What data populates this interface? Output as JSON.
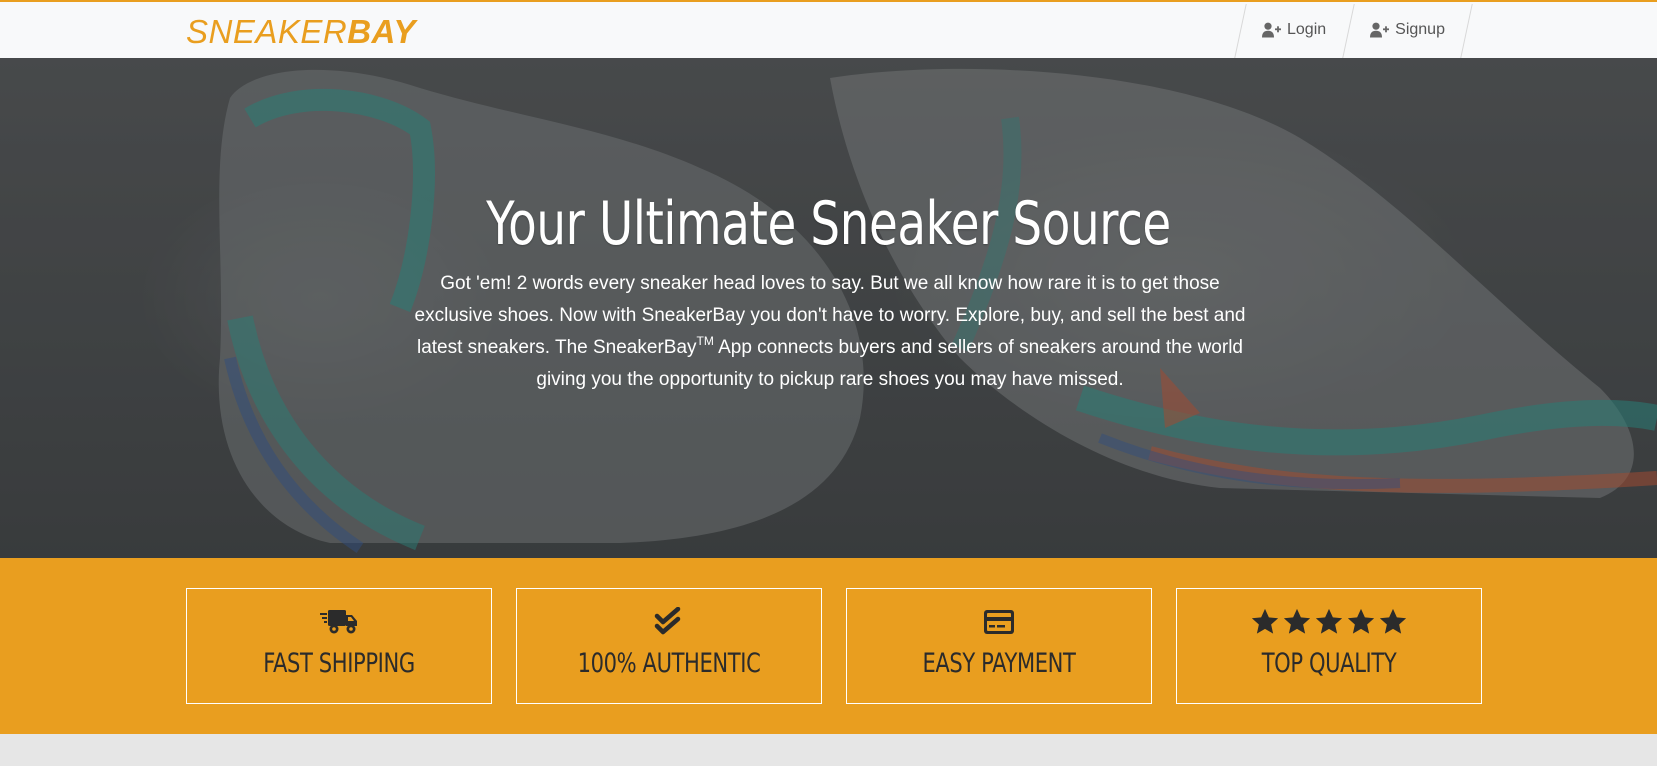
{
  "colors": {
    "accent": "#e99e1f",
    "navbar_bg": "#f8f9fa",
    "hero_text": "#ffffff",
    "feature_text": "#2b2b2b",
    "page_bg": "#e6e6e6"
  },
  "navbar": {
    "brand_light": "SNEAKER",
    "brand_bold": "BAY",
    "links": [
      {
        "label": "Login",
        "icon": "user-plus-icon"
      },
      {
        "label": "Signup",
        "icon": "user-plus-icon"
      }
    ]
  },
  "hero": {
    "title": "Your Ultimate Sneaker Source",
    "text_before_tm": "Got 'em! 2 words every sneaker head loves to say. But we all know how rare it is to get those exclusive shoes. Now with SneakerBay you don't have to worry. Explore, buy, and sell the best and latest sneakers. The SneakerBay",
    "tm": "TM",
    "text_after_tm": " App connects buyers and sellers of sneakers around the world giving you the opportunity to pickup rare shoes you may have missed."
  },
  "features": [
    {
      "label": "FAST SHIPPING",
      "icon": "shipping-fast-icon"
    },
    {
      "label": "100% AUTHENTIC",
      "icon": "check-double-icon"
    },
    {
      "label": "EASY PAYMENT",
      "icon": "credit-card-icon"
    },
    {
      "label": "TOP QUALITY",
      "icon": "five-stars-icon",
      "rating": 5
    }
  ]
}
